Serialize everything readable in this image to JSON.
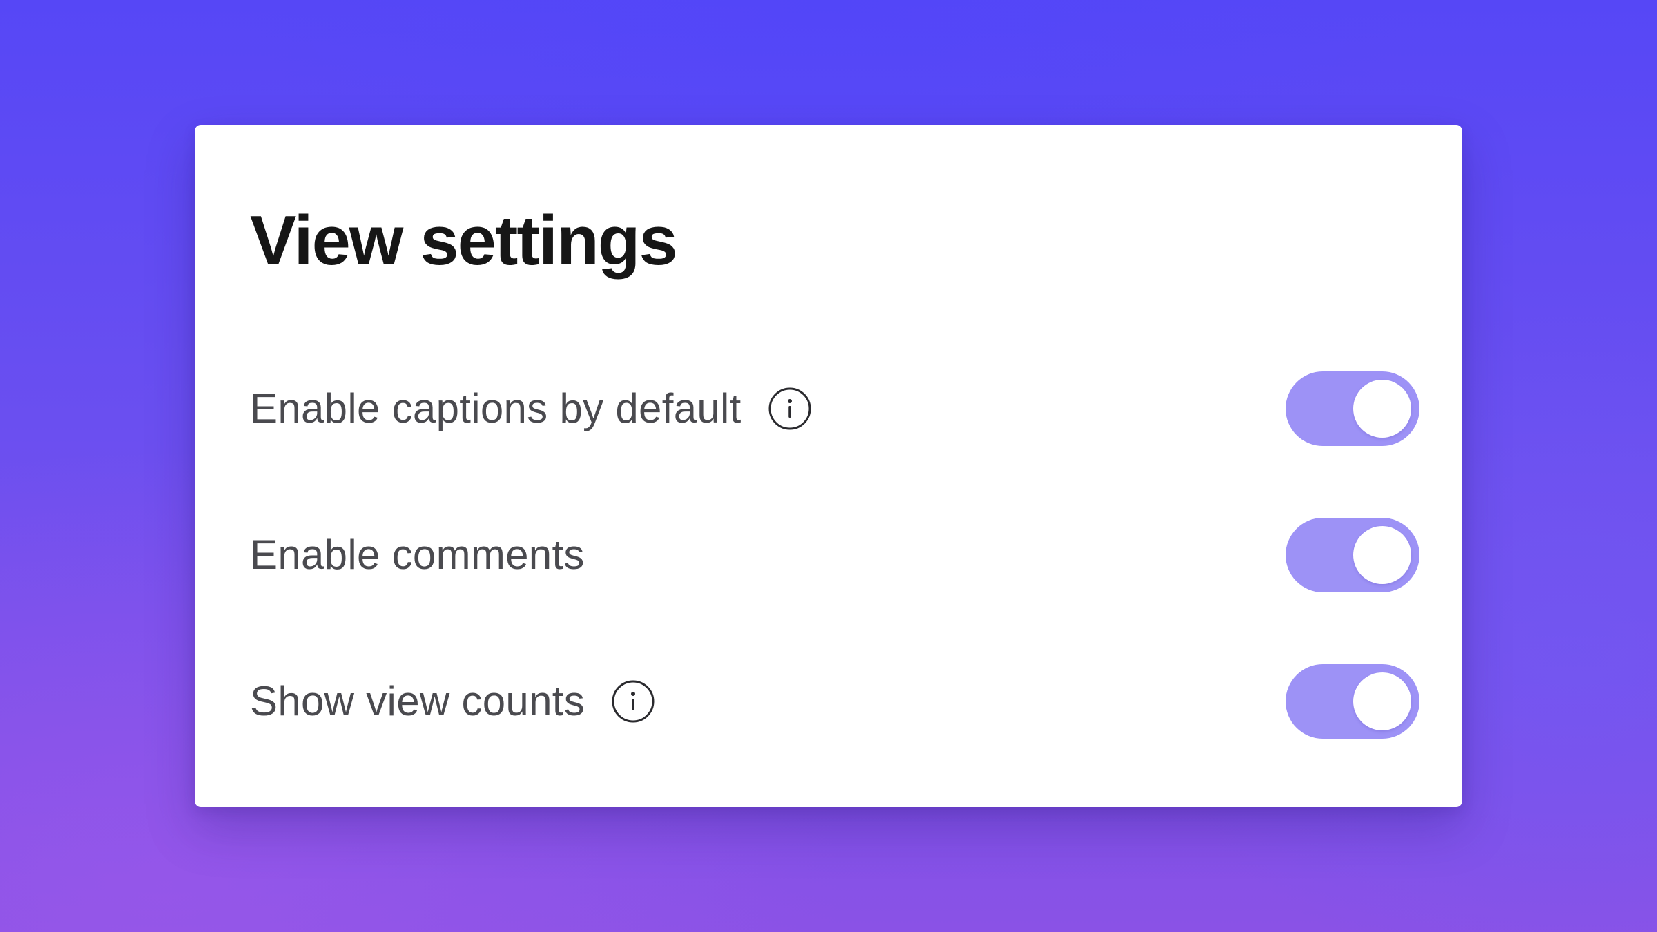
{
  "panel": {
    "title": "View settings"
  },
  "settings": [
    {
      "label": "Enable captions by default",
      "has_info": true,
      "enabled": true
    },
    {
      "label": "Enable comments",
      "has_info": false,
      "enabled": true
    },
    {
      "label": "Show view counts",
      "has_info": true,
      "enabled": true
    }
  ],
  "icons": {
    "info": "info-circle-icon"
  },
  "colors": {
    "background_top": "#5647f6",
    "background_bottom": "#8a52e6",
    "toggle_on": "#9d92f6",
    "card": "#ffffff",
    "title_text": "#161616",
    "label_text": "#4a4a4f"
  }
}
